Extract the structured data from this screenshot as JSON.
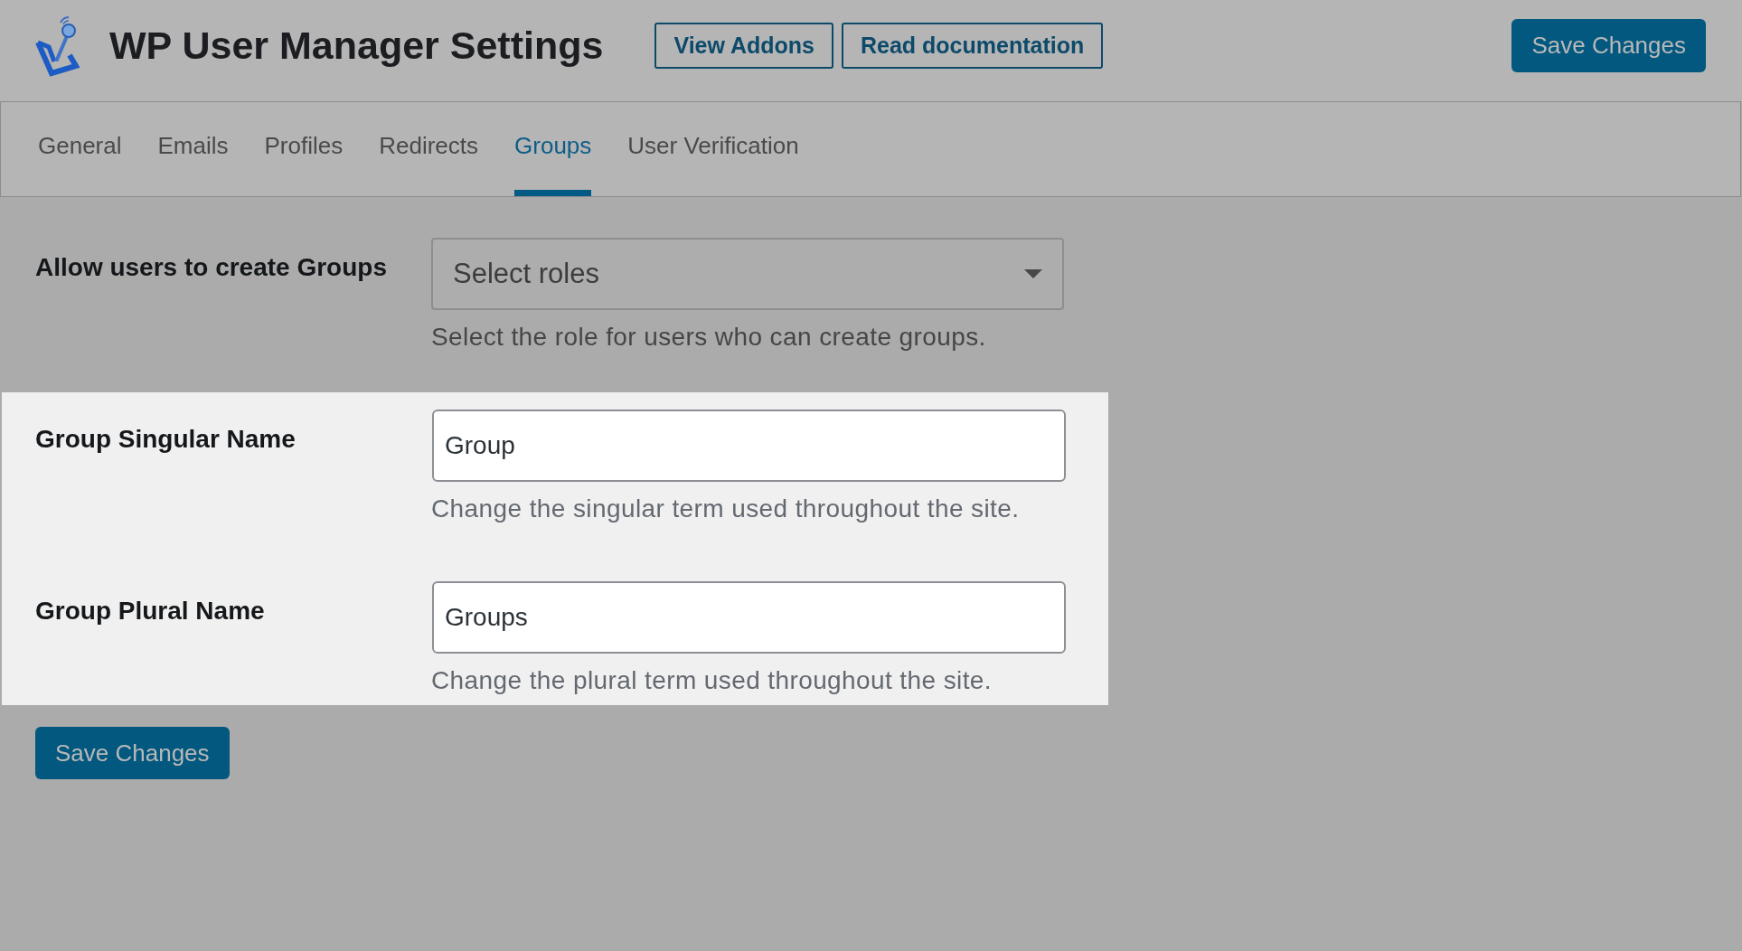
{
  "header": {
    "title": "WP User Manager Settings",
    "links": [
      {
        "label": "View Addons"
      },
      {
        "label": "Read documentation"
      }
    ],
    "save_button": {
      "label": "Save Changes"
    }
  },
  "tabs": [
    {
      "label": "General",
      "selected": false
    },
    {
      "label": "Emails",
      "selected": false
    },
    {
      "label": "Profiles",
      "selected": false
    },
    {
      "label": "Redirects",
      "selected": false
    },
    {
      "label": "Groups",
      "selected": true
    },
    {
      "label": "User Verification",
      "selected": false
    }
  ],
  "fields": [
    {
      "kind": "select",
      "label": "Allow users to create Groups",
      "placeholder": "Select roles",
      "description": "Select the role for users who can create groups.",
      "highlighted": false
    },
    {
      "kind": "text",
      "label": "Group Singular Name",
      "value": "Group",
      "description": "Change the singular term used throughout the site.",
      "highlighted": true
    },
    {
      "kind": "text",
      "label": "Group Plural Name",
      "value": "Groups",
      "description": "Change the plural term used throughout the site.",
      "highlighted": true
    }
  ],
  "footer": {
    "save_button": {
      "label": "Save Changes"
    }
  }
}
